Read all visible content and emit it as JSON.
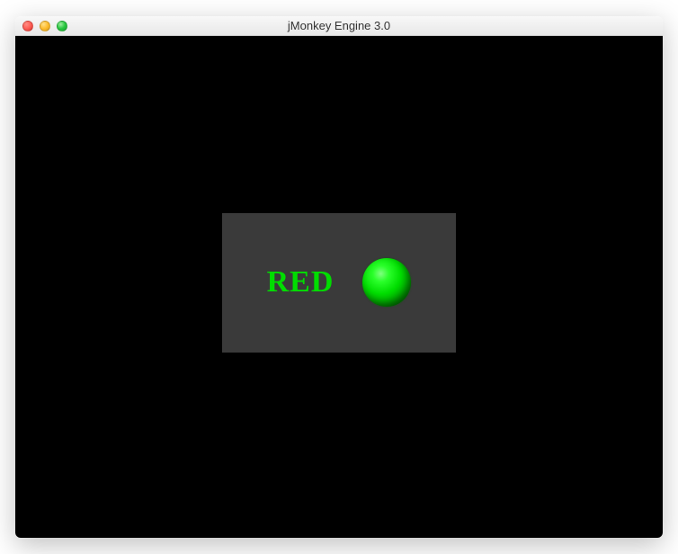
{
  "window": {
    "title": "jMonkey Engine 3.0"
  },
  "panel": {
    "label": "RED",
    "label_color": "#00dd00",
    "sphere_color": "#00dd00",
    "background": "#3a3a3a"
  },
  "viewport": {
    "background": "#000000"
  }
}
